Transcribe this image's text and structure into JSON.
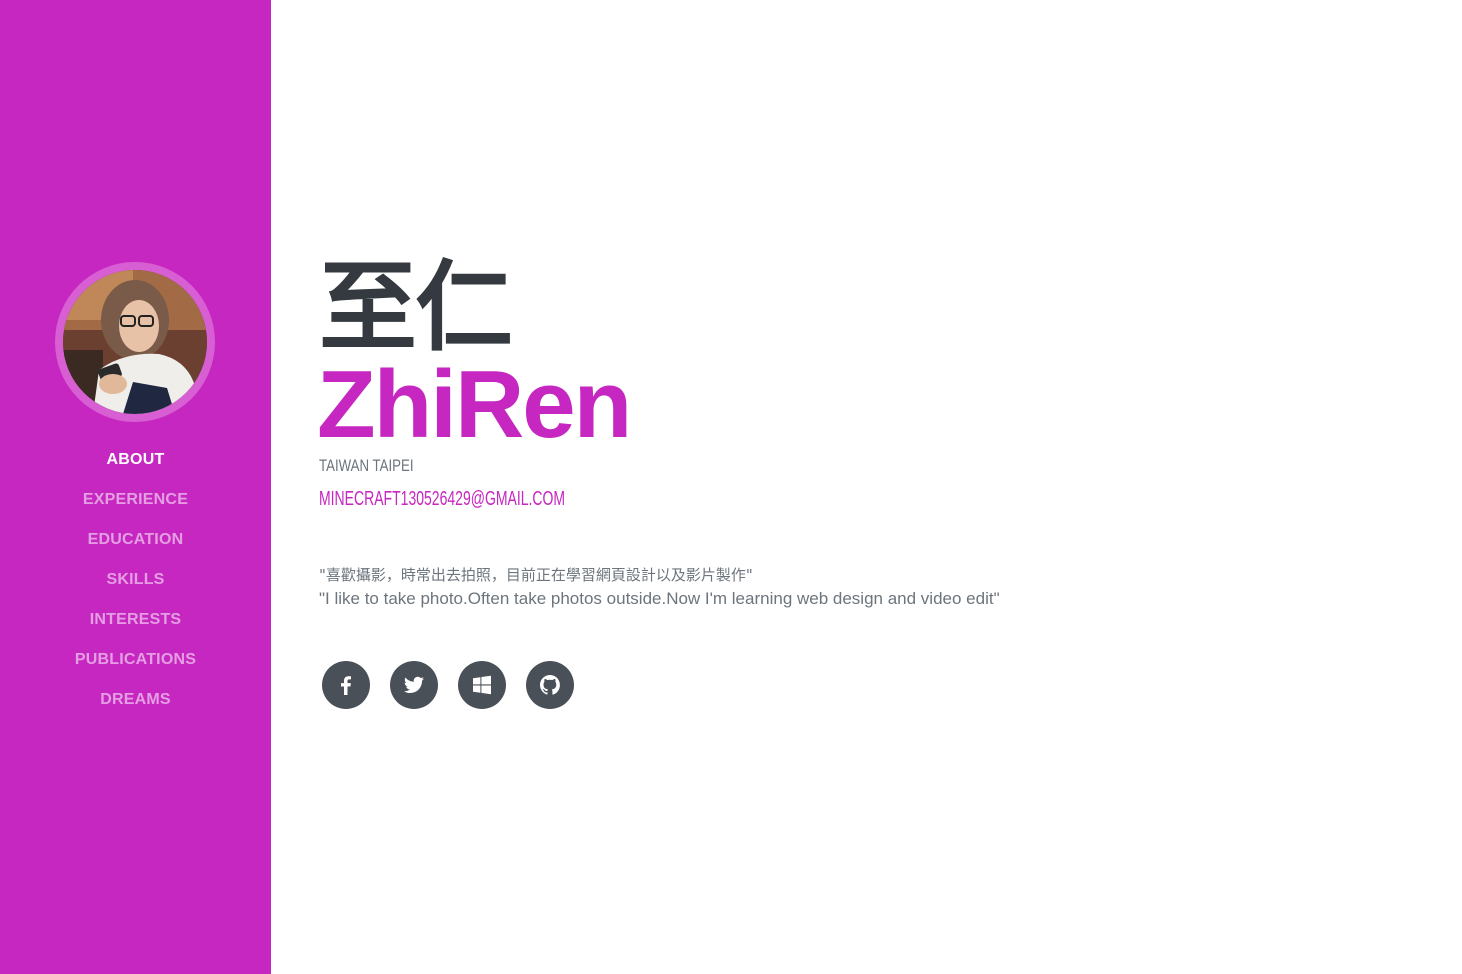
{
  "sidebar": {
    "background": "#c627c0",
    "avatar_alt": "profile photo",
    "nav": [
      {
        "label": "ABOUT",
        "active": true
      },
      {
        "label": "EXPERIENCE",
        "active": false
      },
      {
        "label": "EDUCATION",
        "active": false
      },
      {
        "label": "SKILLS",
        "active": false
      },
      {
        "label": "INTERESTS",
        "active": false
      },
      {
        "label": "PUBLICATIONS",
        "active": false
      },
      {
        "label": "DREAMS",
        "active": false
      }
    ]
  },
  "about": {
    "name_cn": "至仁",
    "name_en": "ZhiRen",
    "location": "TAIWAN TAIPEI",
    "email": "MINECRAFT130526429@GMAIL.COM",
    "quote_cn": "\"喜歡攝影，時常出去拍照，目前正在學習網頁設計以及影片製作\"",
    "quote_en": "\"I like to take photo.Often take photos outside.Now I'm learning web design and video edit\""
  },
  "social": [
    {
      "icon": "facebook-icon"
    },
    {
      "icon": "twitter-icon"
    },
    {
      "icon": "windows-icon"
    },
    {
      "icon": "github-icon"
    }
  ],
  "colors": {
    "primary": "#c627c0",
    "dark": "#343a40",
    "muted": "#6c757d",
    "icon_bg": "#495057"
  }
}
